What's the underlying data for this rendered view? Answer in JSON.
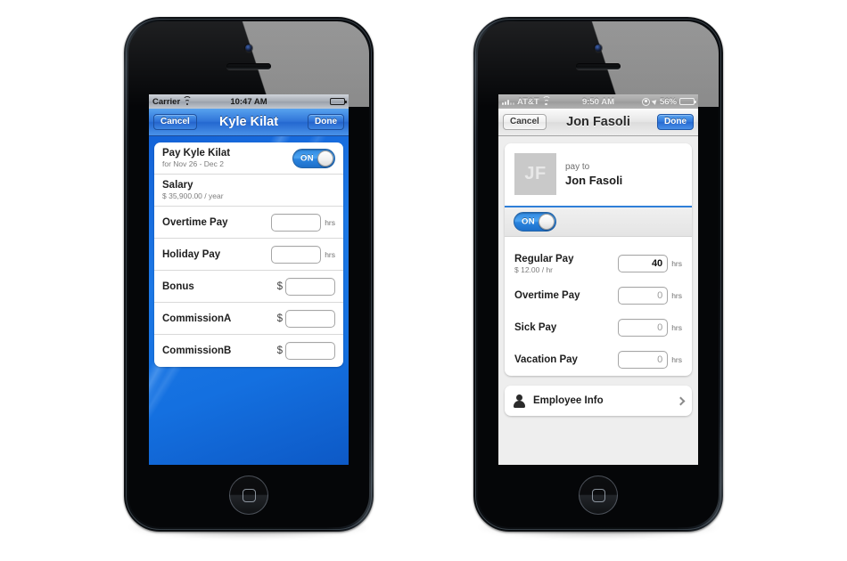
{
  "phones": [
    {
      "id": "left",
      "status_bar": {
        "carrier": "Carrier",
        "wifi_icon": "wifi-icon",
        "time": "10:47 AM",
        "battery_icon": "battery-full-icon"
      },
      "nav_bar": {
        "cancel_label": "Cancel",
        "title": "Kyle Kilat",
        "done_label": "Done"
      },
      "header_row": {
        "label": "Pay Kyle Kilat",
        "sub": "for Nov 26 - Dec 2",
        "toggle_label": "ON",
        "toggle_state": "on"
      },
      "salary_row": {
        "label": "Salary",
        "sub": "$ 35,900.00 / year"
      },
      "rows": [
        {
          "label": "Overtime Pay",
          "prefix": "",
          "value": "",
          "unit": "hrs"
        },
        {
          "label": "Holiday Pay",
          "prefix": "",
          "value": "",
          "unit": "hrs"
        },
        {
          "label": "Bonus",
          "prefix": "$",
          "value": "",
          "unit": ""
        },
        {
          "label": "CommissionA",
          "prefix": "$",
          "value": "",
          "unit": ""
        },
        {
          "label": "CommissionB",
          "prefix": "$",
          "value": "",
          "unit": ""
        }
      ]
    },
    {
      "id": "right",
      "status_bar": {
        "signal_icon": "signal-bars-icon",
        "carrier": "AT&T",
        "wifi_icon": "wifi-icon",
        "time": "9:50 AM",
        "rotation_lock_icon": "rotation-lock-icon",
        "location_icon": "location-arrow-icon",
        "battery_percent": "56%",
        "battery_icon": "battery-icon"
      },
      "nav_bar": {
        "cancel_label": "Cancel",
        "title": "Jon Fasoli",
        "done_label": "Done"
      },
      "pay_to": {
        "avatar_initials": "JF",
        "caption": "pay to",
        "name": "Jon Fasoli"
      },
      "toggle": {
        "label": "ON",
        "state": "on"
      },
      "rows": [
        {
          "label": "Regular Pay",
          "sub": "$ 12.00 / hr",
          "value": "40",
          "unit": "hrs",
          "filled": true
        },
        {
          "label": "Overtime Pay",
          "sub": "",
          "value": "0",
          "unit": "hrs",
          "filled": false
        },
        {
          "label": "Sick Pay",
          "sub": "",
          "value": "0",
          "unit": "hrs",
          "filled": false
        },
        {
          "label": "Vacation Pay",
          "sub": "",
          "value": "0",
          "unit": "hrs",
          "filled": false
        }
      ],
      "employee_info": {
        "label": "Employee Info",
        "icon": "person-icon",
        "chevron": "chevron-right-icon"
      }
    }
  ],
  "colors": {
    "accent_blue": "#2f7fd8",
    "nav_blue": "#2f74d8",
    "wallpaper_blue": "#1470e0",
    "screen_gray": "#eeeeee",
    "toggle_on": "#2a83de"
  }
}
